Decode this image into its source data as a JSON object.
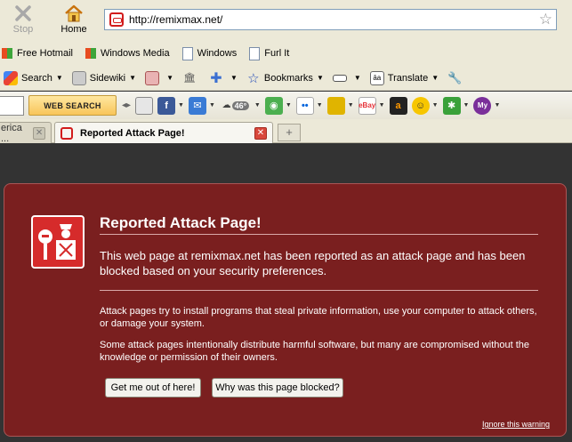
{
  "nav": {
    "stop_label": "Stop",
    "home_label": "Home",
    "url": "http://remixmax.net/"
  },
  "bookmarks_bar": [
    {
      "label": "Free Hotmail",
      "icon": "windows-flag-icon"
    },
    {
      "label": "Windows Media",
      "icon": "windows-flag-icon"
    },
    {
      "label": "Windows",
      "icon": "page-icon"
    },
    {
      "label": "Furl It",
      "icon": "page-icon"
    }
  ],
  "google_toolbar": {
    "search_label": "Search",
    "sidewiki_label": "Sidewiki",
    "bookmarks_label": "Bookmarks",
    "translate_label": "Translate"
  },
  "ix_toolbar": {
    "web_search_label": "WEB SEARCH",
    "weather_temp": "46°",
    "facebook_letter": "f",
    "ebay_label": "eBay",
    "amazon_letter": "a",
    "my_label": "My"
  },
  "tabs": [
    {
      "label": "erica ...",
      "active": false
    },
    {
      "label": "Reported Attack Page!",
      "active": true
    }
  ],
  "newtab_label": "+",
  "warning": {
    "title": "Reported Attack Page!",
    "lead": "This web page at remixmax.net has been reported as an attack page and has been blocked based on your security preferences.",
    "para1": "Attack pages try to install programs that steal private information, use your computer to attack others, or damage your system.",
    "para2": "Some attack pages intentionally distribute harmful software, but many are compromised without the knowledge or permission of their owners.",
    "btn_get_out": "Get me out of here!",
    "btn_why": "Why was this page blocked?",
    "ignore_link": "Ignore this warning"
  },
  "colors": {
    "panel_bg": "#7a1f1f",
    "content_bg": "#333333",
    "badge_red": "#d62b2b",
    "chrome_bg": "#ece9d8"
  }
}
